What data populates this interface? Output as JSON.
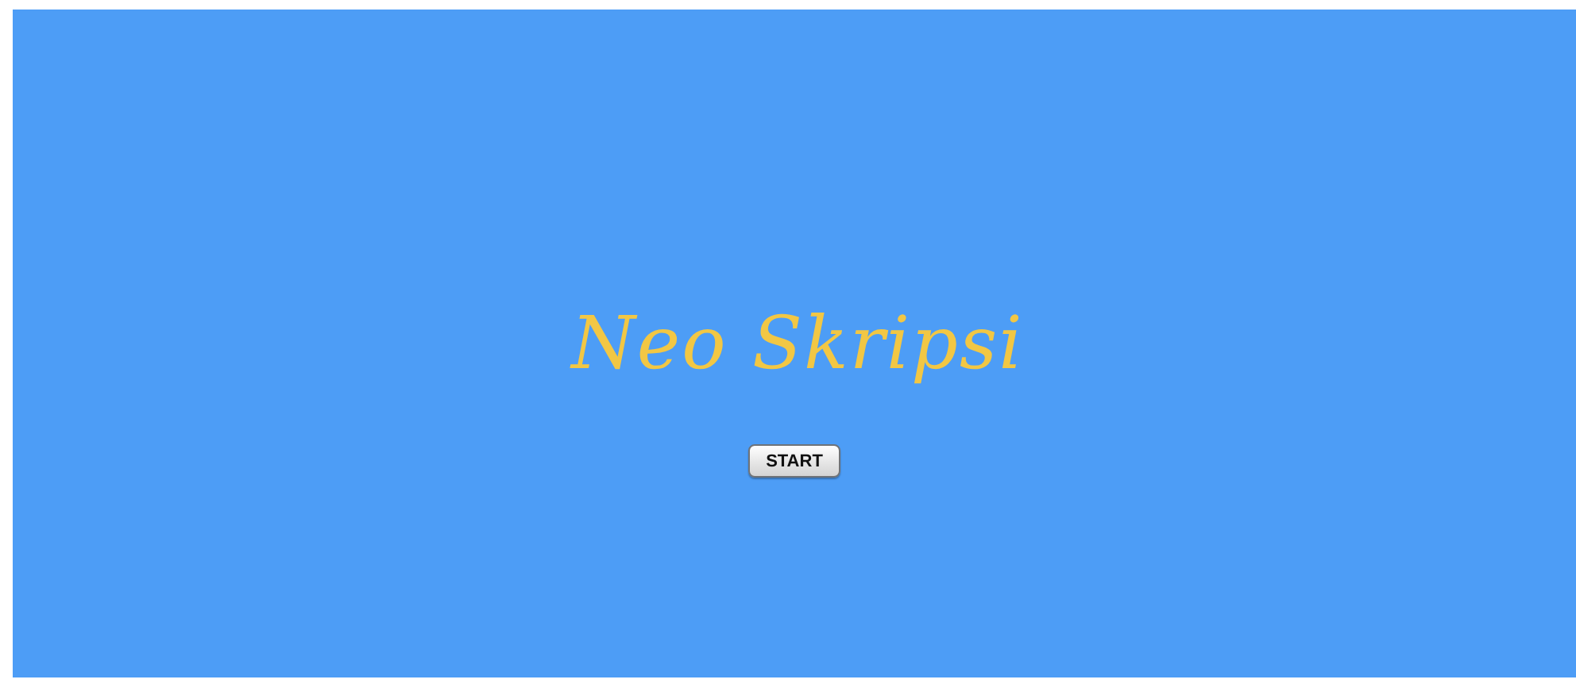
{
  "title": "Neo Skripsi",
  "buttons": [
    {
      "label": "START"
    }
  ]
}
